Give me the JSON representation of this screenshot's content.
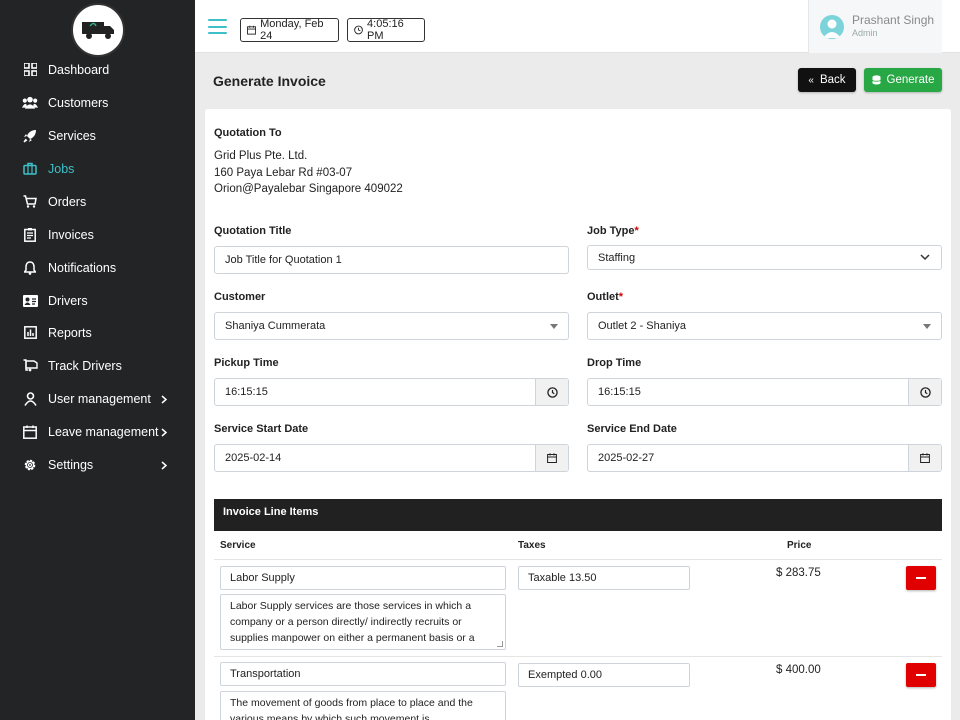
{
  "sidebar": {
    "items": [
      {
        "label": "Dashboard",
        "icon": "dashboard-icon"
      },
      {
        "label": "Customers",
        "icon": "users-icon"
      },
      {
        "label": "Services",
        "icon": "rocket-icon"
      },
      {
        "label": "Jobs",
        "icon": "briefcase-icon",
        "active": true
      },
      {
        "label": "Orders",
        "icon": "cart-icon"
      },
      {
        "label": "Invoices",
        "icon": "invoice-icon"
      },
      {
        "label": "Notifications",
        "icon": "bell-icon"
      },
      {
        "label": "Drivers",
        "icon": "id-card-icon"
      },
      {
        "label": "Reports",
        "icon": "chart-icon"
      },
      {
        "label": "Track Drivers",
        "icon": "truck-icon"
      },
      {
        "label": "User management",
        "icon": "user-icon",
        "expandable": true
      },
      {
        "label": "Leave management",
        "icon": "calendar-icon",
        "expandable": true
      },
      {
        "label": "Settings",
        "icon": "gear-icon",
        "expandable": true
      }
    ]
  },
  "topbar": {
    "date": "Monday, Feb 24",
    "time": "4:05:16 PM",
    "user_name": "Prashant Singh",
    "user_role": "Admin"
  },
  "page": {
    "title": "Generate Invoice",
    "back_label": "Back",
    "generate_label": "Generate"
  },
  "form": {
    "quotation_to_label": "Quotation To",
    "address": [
      "Grid Plus Pte. Ltd.",
      "160 Paya Lebar Rd #03-07",
      "Orion@Payalebar Singapore 409022"
    ],
    "quotation_title_label": "Quotation Title",
    "quotation_title_value": "Job Title for Quotation 1",
    "job_type_label": "Job Type",
    "job_type_value": "Staffing",
    "customer_label": "Customer",
    "customer_value": "Shaniya Cummerata",
    "outlet_label": "Outlet",
    "outlet_value": "Outlet 2 - Shaniya",
    "pickup_label": "Pickup Time",
    "pickup_value": "16:15:15",
    "drop_label": "Drop Time",
    "drop_value": "16:15:15",
    "start_label": "Service Start Date",
    "start_value": "2025-02-14",
    "end_label": "Service End Date",
    "end_value": "2025-02-27",
    "required_mark": "*"
  },
  "line_items": {
    "title": "Invoice Line Items",
    "columns": [
      "Service",
      "Taxes",
      "Price"
    ],
    "rows": [
      {
        "service": "Labor Supply",
        "tax": "Taxable 13.50",
        "price": "$ 283.75",
        "description": "Labor Supply services are those services in which a company or a person directly/ indirectly recruits or supplies manpower on either a permanent basis or a"
      },
      {
        "service": "Transportation",
        "tax": "Exempted 0.00",
        "price": "$ 400.00",
        "description": "The movement of goods from place to place and the various means by which such movement is"
      }
    ]
  },
  "colors": {
    "accent": "#3cc1c9",
    "sidebar_bg": "#222426",
    "generate_green": "#28a745",
    "remove_red": "#e00000"
  }
}
